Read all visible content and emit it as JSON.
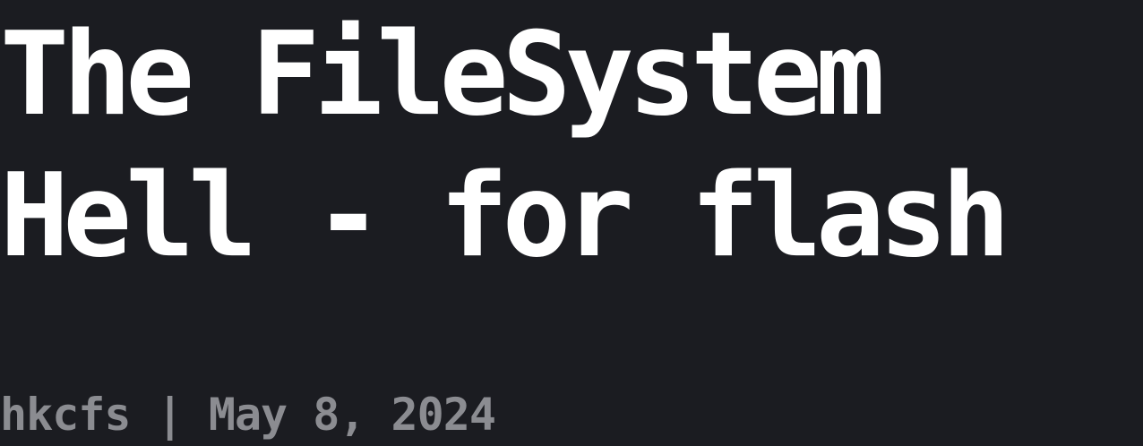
{
  "post": {
    "title_line1": "The FileSystem",
    "title_line2": "Hell - for flash",
    "author": "hkcfs",
    "separator": "|",
    "date": "May 8, 2024"
  },
  "colors": {
    "background": "#1b1c21",
    "title": "#ffffff",
    "meta": "#8b8c91"
  }
}
